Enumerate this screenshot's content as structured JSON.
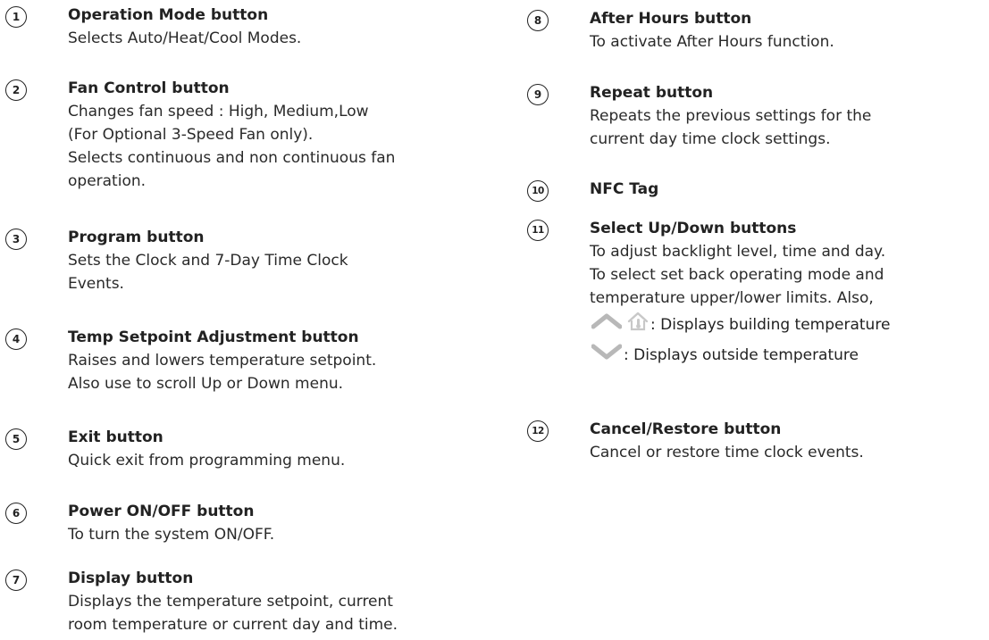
{
  "left": [
    {
      "num": "1",
      "title": "Operation Mode button",
      "lines": [
        "Selects Auto/Heat/Cool Modes."
      ]
    },
    {
      "num": "2",
      "title": "Fan Control button",
      "lines": [
        "Changes fan speed : High, Medium,Low",
        "(For Optional 3-Speed Fan only).",
        "Selects continuous and non continuous fan",
        "operation."
      ]
    },
    {
      "num": "3",
      "title": "Program button",
      "lines": [
        "Sets the Clock and 7-Day Time Clock",
        "Events."
      ]
    },
    {
      "num": "4",
      "title": "Temp Setpoint Adjustment button",
      "lines": [
        "Raises and lowers temperature setpoint.",
        "Also use to scroll Up or Down menu."
      ]
    },
    {
      "num": "5",
      "title": "Exit button",
      "lines": [
        "Quick exit from programming menu."
      ]
    },
    {
      "num": "6",
      "title": "Power ON/OFF button",
      "lines": [
        "To turn the system ON/OFF."
      ]
    },
    {
      "num": "7",
      "title": "Display button",
      "lines": [
        "Displays the temperature setpoint, current",
        "room temperature or current day and time."
      ]
    }
  ],
  "right": [
    {
      "num": "8",
      "title": "After Hours button",
      "lines": [
        "To activate After Hours function."
      ]
    },
    {
      "num": "9",
      "title": "Repeat button",
      "lines": [
        "Repeats the previous settings for the",
        "current day time clock settings."
      ]
    },
    {
      "num": "10",
      "title": "NFC Tag",
      "lines": []
    },
    {
      "num": "11",
      "title": "Select Up/Down buttons",
      "lines": [
        "To adjust backlight level, time and day.",
        "To select set back operating mode and",
        "temperature upper/lower limits. Also,"
      ],
      "icon_lines": [
        ": Displays building temperature",
        ": Displays outside temperature"
      ]
    },
    {
      "num": "12",
      "title": "Cancel/Restore button",
      "lines": [
        "Cancel or restore time clock events."
      ]
    }
  ],
  "icons": {
    "up": "chevron-up-icon",
    "house": "house-thermometer-icon",
    "down": "chevron-down-icon",
    "chevron_color": "#b8b8b8",
    "house_color": "#c8c8c8"
  }
}
